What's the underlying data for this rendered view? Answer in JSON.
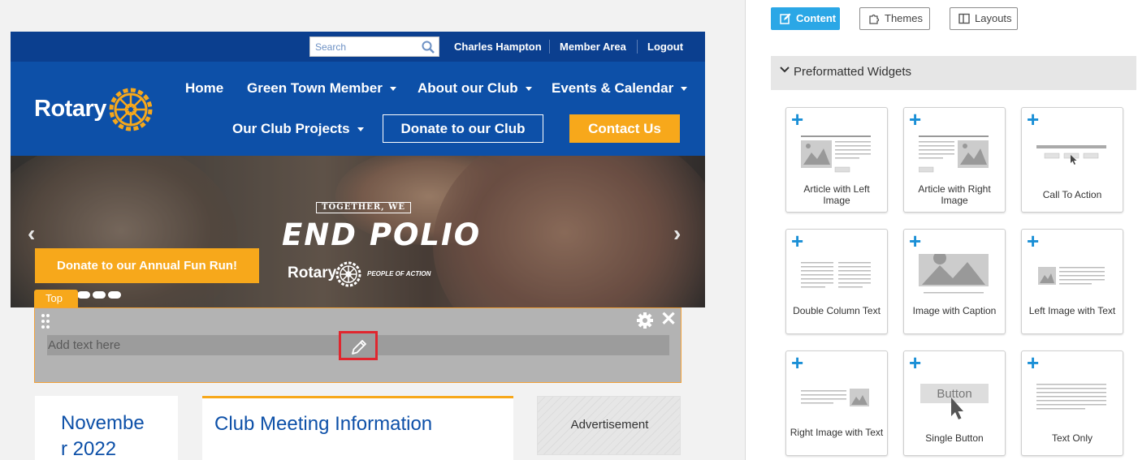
{
  "site": {
    "search": {
      "placeholder": "Search"
    },
    "top_links": [
      "Charles Hampton",
      "Member Area",
      "Logout"
    ],
    "logo_text": "Rotary",
    "nav": {
      "home": "Home",
      "green_town_member": "Green Town Member",
      "about_our_club": "About our Club",
      "events_calendar": "Events & Calendar",
      "our_club_projects": "Our Club Projects",
      "donate": "Donate to our Club",
      "contact": "Contact Us"
    },
    "hero": {
      "tagline": "TOGETHER, WE",
      "headline": "END POLIO",
      "brand": "Rotary",
      "brand_sub": "PEOPLE OF ACTION",
      "cta": "Donate to our Annual Fun Run!",
      "prev_arrow": "‹",
      "next_arrow": "›"
    },
    "edit_block": {
      "tab_label": "Top",
      "placeholder_text": "Add text here",
      "close_glyph": "✕"
    },
    "cards": {
      "date": "November 2022",
      "meeting_title": "Club Meeting Information",
      "advertisement": "Advertisement"
    }
  },
  "panel": {
    "tabs": {
      "content": "Content",
      "themes": "Themes",
      "layouts": "Layouts"
    },
    "section_title": "Preformatted Widgets",
    "widgets": [
      {
        "label": "Article with Left Image",
        "icon": "article-left-image-icon"
      },
      {
        "label": "Article with Right Image",
        "icon": "article-right-image-icon"
      },
      {
        "label": "Call To Action",
        "icon": "call-to-action-icon"
      },
      {
        "label": "Double Column Text",
        "icon": "double-column-text-icon"
      },
      {
        "label": "Image with Caption",
        "icon": "image-caption-icon"
      },
      {
        "label": "Left Image with Text",
        "icon": "left-image-text-icon"
      },
      {
        "label": "Right Image with Text",
        "icon": "right-image-text-icon"
      },
      {
        "label": "Single Button",
        "icon": "single-button-icon",
        "button_text": "Button"
      },
      {
        "label": "Text Only",
        "icon": "text-only-icon"
      }
    ],
    "plus_glyph": "+"
  },
  "colors": {
    "rotary_blue": "#0d50a8",
    "rotary_gold": "#f7a81b",
    "accent_blue": "#2ba7e6",
    "highlight_red": "#e0262e"
  }
}
